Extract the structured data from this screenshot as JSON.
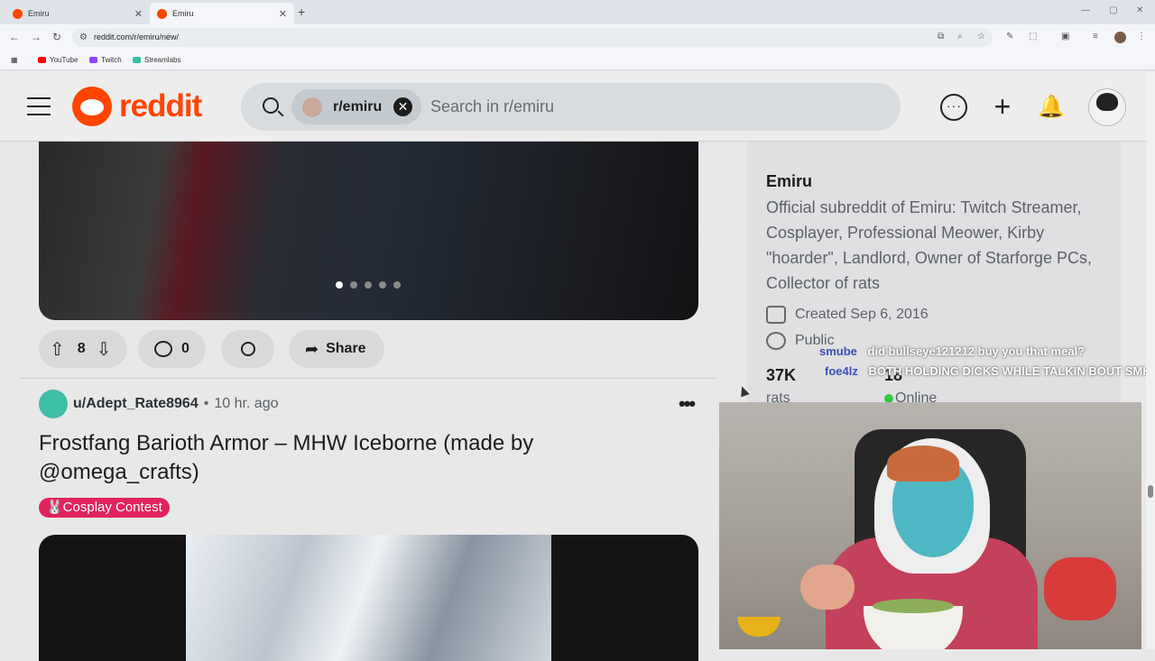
{
  "browser": {
    "tabs": [
      {
        "label": "Emiru",
        "close": "✕"
      },
      {
        "label": "Emiru",
        "close": "✕"
      }
    ],
    "new_tab": "+",
    "window_controls": [
      "—",
      "▢",
      "✕"
    ],
    "url": "reddit.com/r/emiru/new/",
    "bookmarks": [
      {
        "label": "YouTube",
        "color": "#ff0000"
      },
      {
        "label": "Twitch",
        "color": "#9146ff"
      },
      {
        "label": "Streamlabs",
        "color": "#31c3a2"
      }
    ]
  },
  "header": {
    "logo": "reddit",
    "search_chip": "r/emiru",
    "search_chip_clear": "✕",
    "search_placeholder": "Search in r/emiru",
    "icons": [
      "chat-icon",
      "plus-icon",
      "bell-icon",
      "avatar"
    ]
  },
  "feed": {
    "prev_post": {
      "upvotes": "8",
      "comments": "0",
      "share_label": "Share",
      "carousel_dots": 5,
      "active_dot": 0
    },
    "post": {
      "author": "u/Adept_Rate8964",
      "separator": "•",
      "time": "10 hr. ago",
      "menu": "•••",
      "title": "Frostfang Barioth Armor – MHW Iceborne (made by @omega_crafts)",
      "flair": "🐰Cosplay Contest",
      "flair_color": "#e0245e"
    }
  },
  "sidebar": {
    "name": "Emiru",
    "description": "Official subreddit of Emiru: Twitch Streamer, Cosplayer, Professional Meower, Kirby \"hoarder\", Landlord, Owner of Starforge PCs, Collector of rats",
    "created": "Created Sep 6, 2016",
    "visibility": "Public",
    "members": "37K",
    "members_label": "rats",
    "online_count": "18",
    "online_label": "Online"
  },
  "stream_chat": [
    {
      "user": "smube",
      "message": "did bullseye121212 buy you that meal?"
    },
    {
      "user": "foe4lz",
      "message": "BOTH HOLDING DICKS WHILE TALKIN BOUT SMH"
    }
  ],
  "accent_color": "#ff4500"
}
